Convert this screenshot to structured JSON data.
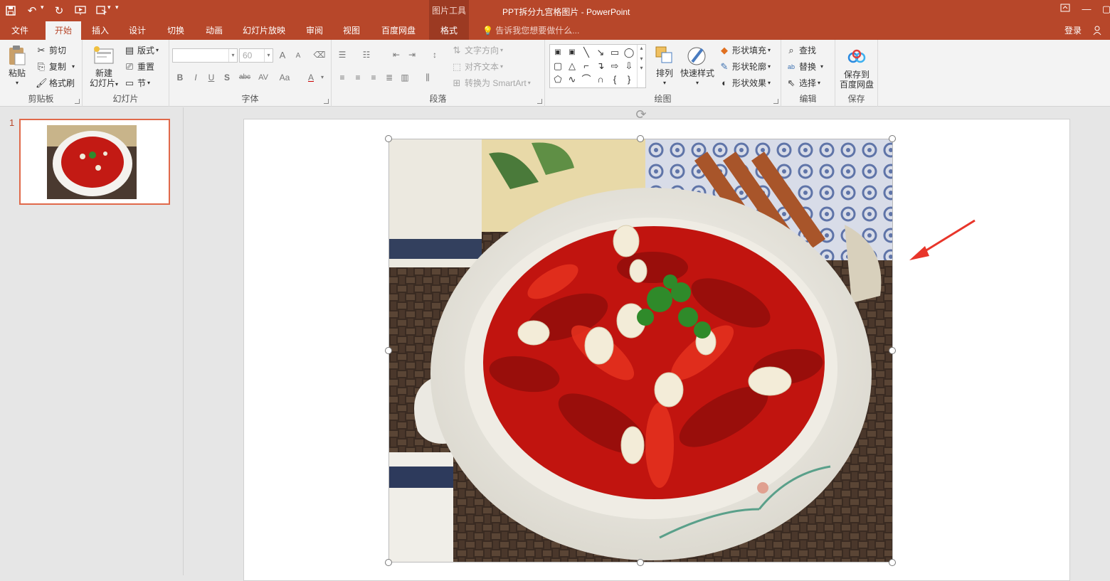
{
  "titlebar": {
    "document_title": "PPT拆分九宫格图片 - PowerPoint",
    "contextual_header": "图片工具",
    "quick_access": [
      "save-icon",
      "undo-icon",
      "redo-icon",
      "start-from-beginning-icon",
      "touch-mode-icon",
      "customize-qat-icon"
    ]
  },
  "tabs": {
    "file": "文件",
    "home": "开始",
    "insert": "插入",
    "design": "设计",
    "transitions": "切换",
    "animations": "动画",
    "slideshow": "幻灯片放映",
    "review": "审阅",
    "view": "视图",
    "baidu": "百度网盘",
    "format": "格式",
    "tell_me": "告诉我您想要做什么...",
    "login": "登录"
  },
  "ribbon": {
    "clipboard": {
      "paste": "粘贴",
      "cut": "剪切",
      "copy": "复制",
      "format_painter": "格式刷",
      "label": "剪贴板"
    },
    "slides": {
      "new_slide_line1": "新建",
      "new_slide_line2": "幻灯片",
      "layout": "版式",
      "reset": "重置",
      "section": "节",
      "label": "幻灯片"
    },
    "font": {
      "font_name": "",
      "font_size": "60",
      "label": "字体",
      "bold": "B",
      "italic": "I",
      "underline": "U",
      "shadow": "S",
      "strike": "abc",
      "spacing": "AV",
      "case": "Aa",
      "color": "A",
      "grow": "A",
      "shrink": "A"
    },
    "paragraph": {
      "text_direction": "文字方向",
      "align_text": "对齐文本",
      "convert_smartart": "转换为 SmartArt",
      "label": "段落"
    },
    "drawing": {
      "arrange": "排列",
      "quick_styles": "快速样式",
      "shape_fill": "形状填充",
      "shape_outline": "形状轮廓",
      "shape_effects": "形状效果",
      "label": "绘图"
    },
    "editing": {
      "find": "查找",
      "replace": "替换",
      "select": "选择",
      "label": "编辑"
    },
    "save": {
      "save_to_line1": "保存到",
      "save_to_line2": "百度网盘",
      "label": "保存"
    }
  },
  "slides_pane": {
    "slide_number": "1"
  },
  "colors": {
    "accent": "#b7472a",
    "accent_dark": "#9c3a22",
    "thumb_border": "#e0694a",
    "arrow": "#e8352a"
  }
}
